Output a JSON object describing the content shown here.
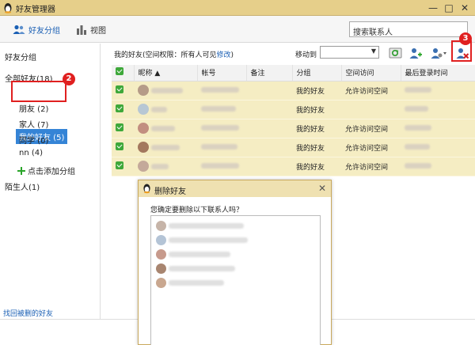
{
  "window": {
    "title": "好友管理器",
    "minimize_glyph": "—",
    "maximize_glyph": "□",
    "close_glyph": "✕"
  },
  "toolbar": {
    "group_label": "好友分组",
    "view_label": "视图",
    "search_placeholder": "搜索联系人"
  },
  "sidebar": {
    "heading": "好友分组",
    "all_friends": "全部好友(18)",
    "items": [
      {
        "label": "我的好友 (5)",
        "selected": true
      },
      {
        "label": "朋友 (2)"
      },
      {
        "label": "家人 (7)"
      },
      {
        "label": "同学 (0)"
      },
      {
        "label": "nn (4)"
      }
    ],
    "add_group": "点击添加分组",
    "strangers": "陌生人(1)",
    "recover_link": "找回被删的好友"
  },
  "content": {
    "permission_prefix": "我的好友(空间权限：所有人可见",
    "permission_link": "修改",
    "permission_suffix": ")",
    "move_to_label": "移动到",
    "move_to_value": "",
    "columns": [
      "昵称 ▲",
      "帐号",
      "备注",
      "分组",
      "空间访问",
      "最后登录时间"
    ],
    "rows": [
      {
        "group": "我的好友",
        "space": "允许访问空间",
        "avatar_color": "#b59b88"
      },
      {
        "group": "我的好友",
        "space": "",
        "avatar_color": "#b7c7d4"
      },
      {
        "group": "我的好友",
        "space": "允许访问空间",
        "avatar_color": "#c28e80"
      },
      {
        "group": "我的好友",
        "space": "允许访问空间",
        "avatar_color": "#a3785e"
      },
      {
        "group": "我的好友",
        "space": "允许访问空间",
        "avatar_color": "#c4a99a"
      }
    ]
  },
  "dialog": {
    "title": "删除好友",
    "close_glyph": "✕",
    "question": "您确定要删除以下联系人吗？",
    "entries": [
      {
        "avatar_color": "#c6b4a8"
      },
      {
        "avatar_color": "#b4c4d6"
      },
      {
        "avatar_color": "#c79a8c"
      },
      {
        "avatar_color": "#a88570"
      },
      {
        "avatar_color": "#c9a78f"
      }
    ]
  },
  "annotations": {
    "step2": "2",
    "step3": "3"
  },
  "icons": {
    "penguin": "qq-penguin-icon",
    "group": "users-icon",
    "view": "bar-chart-icon",
    "refresh": "refresh-contacts-icon",
    "add_friend": "add-friend-icon",
    "friend_menu": "friend-settings-icon",
    "delete_friend": "delete-friend-icon"
  },
  "colors": {
    "titlebar": "#e6cf8a",
    "selected": "#3584d6",
    "row": "#f5edc3",
    "annotation": "#e02020",
    "link": "#1a5fb4"
  }
}
